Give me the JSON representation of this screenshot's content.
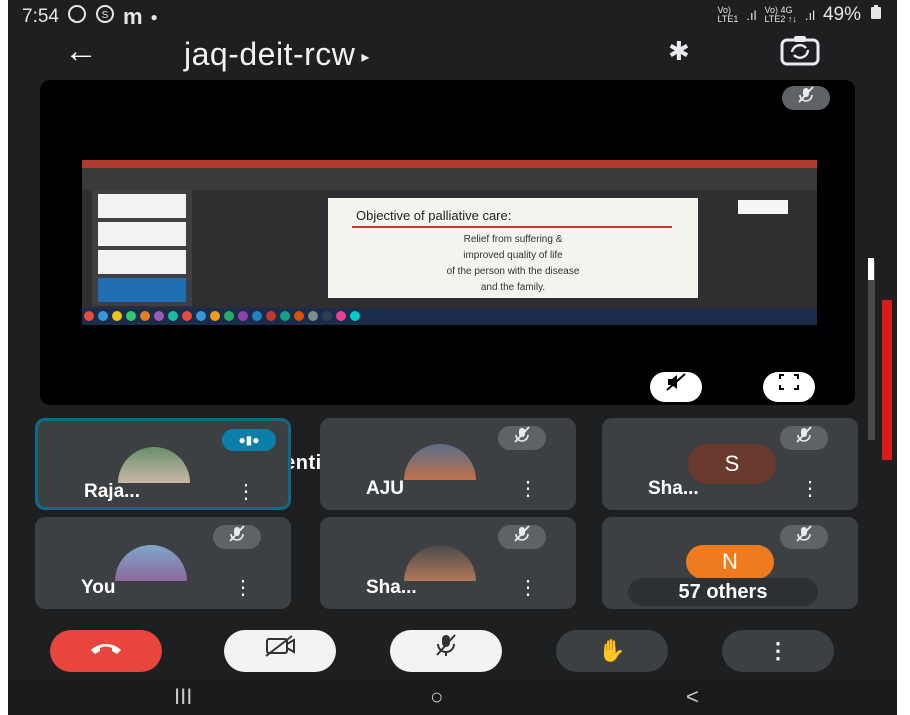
{
  "status_bar": {
    "time": "7:54",
    "left_icons": [
      "whatsapp-icon",
      "skype-icon",
      "m-icon",
      "dot-icon"
    ],
    "battery": "49%"
  },
  "app_bar": {
    "meeting_code": "jaq-deit-rcw",
    "caret": "▸",
    "back_glyph": "←",
    "bluetooth_glyph": "✱"
  },
  "presentation": {
    "presenting_text": "Rajagopal is presenting",
    "slide": {
      "title": "Objective of palliative care:",
      "body_lines": [
        "Relief from suffering &",
        "improved quality of life",
        "of the person with the disease",
        "and the family."
      ]
    }
  },
  "participants": [
    {
      "name": "Raja...",
      "avatar": "photo",
      "speaking": true,
      "muted": false
    },
    {
      "name": "AJU",
      "avatar": "photo",
      "speaking": false,
      "muted": true
    },
    {
      "name": "Sha...",
      "avatar": "letter",
      "letter": "S",
      "avatar_color": "#6b3a2e",
      "muted": true
    },
    {
      "name": "You",
      "avatar": "photo",
      "speaking": false,
      "muted": true
    },
    {
      "name": "Sha...",
      "avatar": "photo",
      "speaking": false,
      "muted": true
    },
    {
      "name": "",
      "avatar": "letter",
      "letter": "N",
      "avatar_color": "#f07a1e",
      "muted": true
    }
  ],
  "others_label": "57 others",
  "controls": {
    "end_call_color": "#e8453c",
    "raise_hand_glyph": "✋",
    "more_glyph": "⋮"
  },
  "nav_bar": {
    "recents": "III",
    "home": "○",
    "back": "<"
  },
  "colors": {
    "background": "#1e1f21",
    "tile": "#3c4043",
    "active_border": "#0f6b85",
    "speaking_pill": "#0b7fa8",
    "scroll_red": "#d81b1b"
  }
}
